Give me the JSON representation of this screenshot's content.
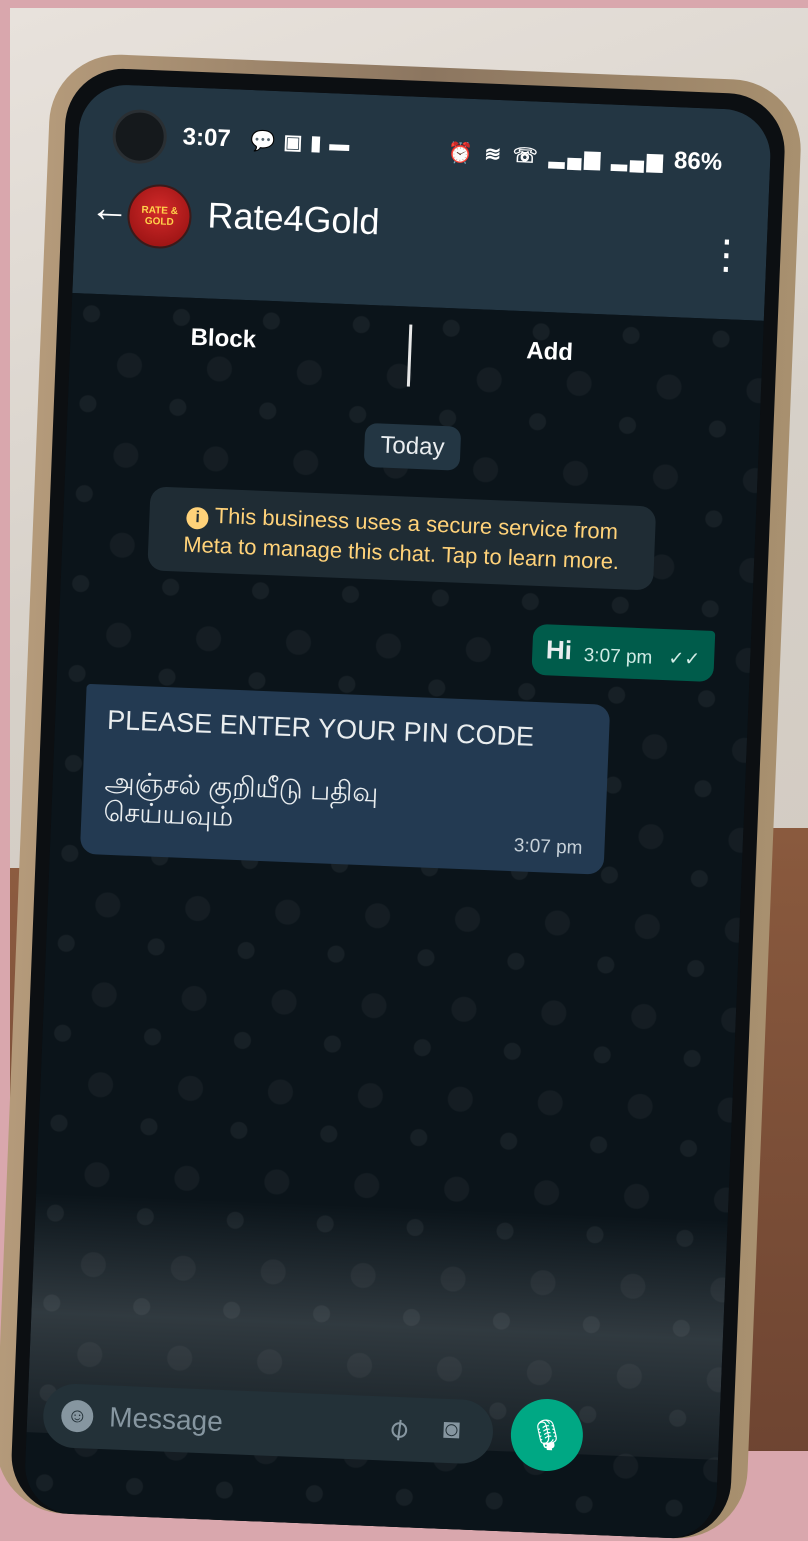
{
  "status_bar": {
    "time": "3:07",
    "battery": "86%",
    "left_icons": [
      "chat-bubble-icon",
      "app-icon",
      "battery-saver-icon",
      "notification-icon"
    ],
    "right_icons": [
      "alarm-icon",
      "wifi-icon",
      "call-icon",
      "signal-icon",
      "signal-icon"
    ]
  },
  "header": {
    "contact_name": "Rate4Gold",
    "avatar_text": "RATE & GOLD"
  },
  "actions": {
    "block": "Block",
    "add": "Add"
  },
  "chat": {
    "date_chip": "Today",
    "business_notice": "This business uses a secure service from Meta to manage this chat. Tap to learn more.",
    "messages": [
      {
        "direction": "outgoing",
        "text": "Hi",
        "time": "3:07 pm",
        "status": "read"
      },
      {
        "direction": "incoming",
        "line1": "PLEASE ENTER YOUR PIN CODE",
        "line2": "அஞ்சல் குறியீடு பதிவு\nசெய்யவும்",
        "time": "3:07 pm"
      }
    ]
  },
  "composer": {
    "placeholder": "Message"
  },
  "colors": {
    "header": "#233643",
    "chat_bg": "#0b141a",
    "outgoing": "#005c4b",
    "incoming": "#233a52",
    "accent": "#00a884"
  }
}
